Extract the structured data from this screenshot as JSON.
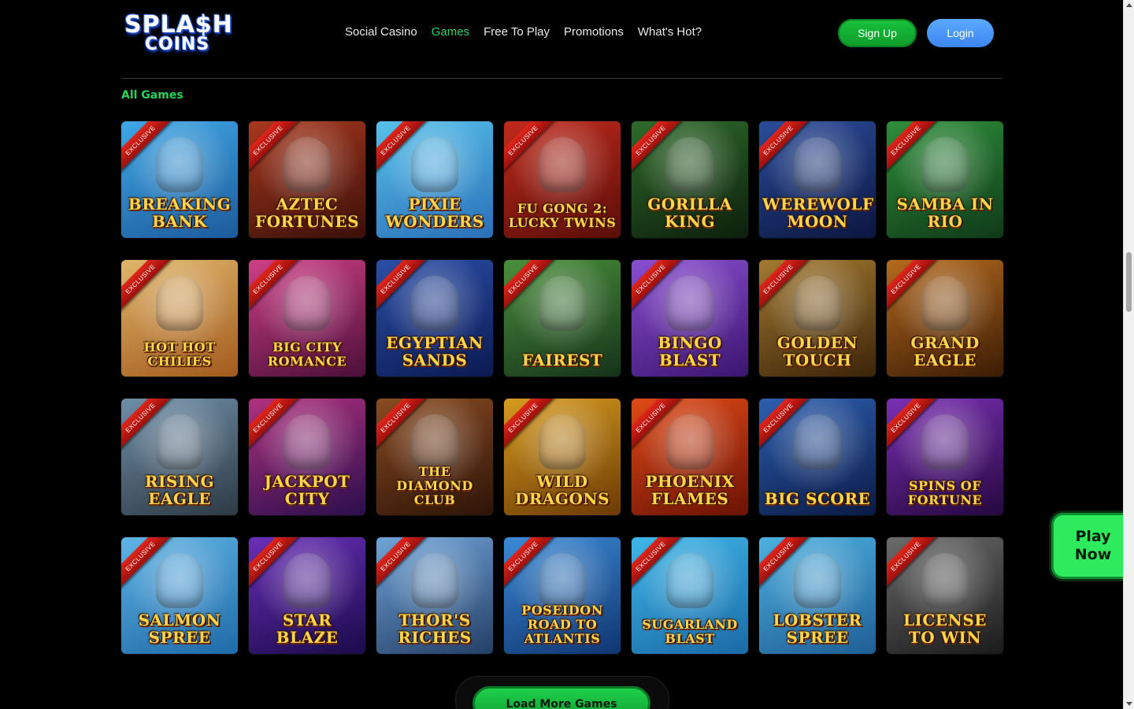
{
  "brand": {
    "logo_line1": "SPLA$H",
    "logo_line2": "COINS"
  },
  "nav": [
    {
      "label": "Social Casino",
      "active": false
    },
    {
      "label": "Games",
      "active": true
    },
    {
      "label": "Free To Play",
      "active": false
    },
    {
      "label": "Promotions",
      "active": false
    },
    {
      "label": "What's Hot?",
      "active": false
    }
  ],
  "auth": {
    "signup_label": "Sign Up",
    "login_label": "Login"
  },
  "section": {
    "title": "All Games"
  },
  "ribbon_label": "EXCLUSIVE",
  "games": [
    {
      "title": "Breaking Bank",
      "bg": [
        "#3fa7e6",
        "#1d5b9b"
      ]
    },
    {
      "title": "Aztec Fortunes",
      "bg": [
        "#a8381e",
        "#3a0f08"
      ]
    },
    {
      "title": "Pixie Wonders",
      "bg": [
        "#56c1ea",
        "#2a6fb8"
      ]
    },
    {
      "title": "Fu Gong 2: Lucky Twins",
      "bg": [
        "#c02a1c",
        "#5a0d08"
      ]
    },
    {
      "title": "Gorilla King",
      "bg": [
        "#2f6b2b",
        "#0c1f0b"
      ]
    },
    {
      "title": "Werewolf Moon",
      "bg": [
        "#2a4c9a",
        "#0b1640"
      ]
    },
    {
      "title": "Samba in Rio",
      "bg": [
        "#2e8f3a",
        "#0f3a18"
      ]
    },
    {
      "title": "Hot Hot Chilies",
      "bg": [
        "#e0b56a",
        "#a25b1e"
      ]
    },
    {
      "title": "Big City Romance",
      "bg": [
        "#cf3f86",
        "#4b0f3a"
      ]
    },
    {
      "title": "Egyptian Sands",
      "bg": [
        "#2b4fa7",
        "#0a1a52"
      ]
    },
    {
      "title": "Fairest",
      "bg": [
        "#4a8f3b",
        "#15331a"
      ]
    },
    {
      "title": "Bingo Blast",
      "bg": [
        "#8a4fd0",
        "#3b1570"
      ]
    },
    {
      "title": "Golden Touch",
      "bg": [
        "#a47a32",
        "#3b2408"
      ]
    },
    {
      "title": "Grand Eagle",
      "bg": [
        "#b56a1e",
        "#3b1c05"
      ]
    },
    {
      "title": "Rising Eagle",
      "bg": [
        "#6f8ea8",
        "#2d3a44"
      ]
    },
    {
      "title": "Jackpot City",
      "bg": [
        "#b0317e",
        "#2a0e4c"
      ]
    },
    {
      "title": "The Diamond Club",
      "bg": [
        "#8a4b22",
        "#2d1407"
      ]
    },
    {
      "title": "Wild Dragons",
      "bg": [
        "#d79b1e",
        "#6b3a05"
      ]
    },
    {
      "title": "Phoenix Flames",
      "bg": [
        "#e04a16",
        "#6b1205"
      ]
    },
    {
      "title": "Big Score",
      "bg": [
        "#2d5fb0",
        "#0a1a44"
      ]
    },
    {
      "title": "Spins of Fortune",
      "bg": [
        "#7a2fb3",
        "#25083f"
      ]
    },
    {
      "title": "Salmon Spree",
      "bg": [
        "#5fb3e4",
        "#1f6aa8"
      ]
    },
    {
      "title": "Star Blaze",
      "bg": [
        "#6a2fb8",
        "#1a0a4a"
      ]
    },
    {
      "title": "Thor's Riches",
      "bg": [
        "#6fa3d8",
        "#243f66"
      ]
    },
    {
      "title": "Poseidon Road to Atlantis",
      "bg": [
        "#3c8ad6",
        "#0f3570"
      ]
    },
    {
      "title": "Sugarland Blast",
      "bg": [
        "#3fb6e8",
        "#1a6aa6"
      ]
    },
    {
      "title": "Lobster Spree",
      "bg": [
        "#4db0e0",
        "#1f5f95"
      ]
    },
    {
      "title": "License to Win",
      "bg": [
        "#6b6b6b",
        "#1a1a1a"
      ]
    }
  ],
  "play_now": {
    "line1": "Play",
    "line2": "Now"
  },
  "load_more_label": "Load More Games"
}
